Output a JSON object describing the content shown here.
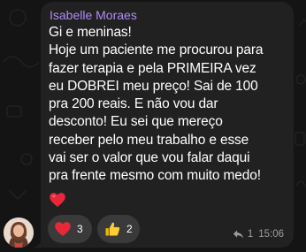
{
  "message": {
    "sender_name": "Isabelle Moraes",
    "lines": [
      "Gi e meninas!",
      "Hoje um paciente me procurou para",
      "fazer terapia e pela PRIMEIRA vez",
      "eu DOBREI meu preço! Sai de 100",
      "pra 200 reais. E não vou dar",
      "desconto! Eu sei que mereço",
      "receber pelo meu trabalho e esse",
      "vai ser o valor que vou falar daqui",
      "pra frente mesmo com muito medo!"
    ],
    "trailing_emoji": "heart-emoji",
    "reactions": [
      {
        "emoji": "red-heart",
        "count": "3"
      },
      {
        "emoji": "thumbs-up",
        "count": "2"
      }
    ],
    "reply_count": "1",
    "time": "15:06"
  },
  "colors": {
    "background": "#141414",
    "bubble": "#212121",
    "sender_name": "#b18cf5",
    "reaction_pill": "#3a3a3a",
    "meta_text": "#9e9e9e"
  }
}
